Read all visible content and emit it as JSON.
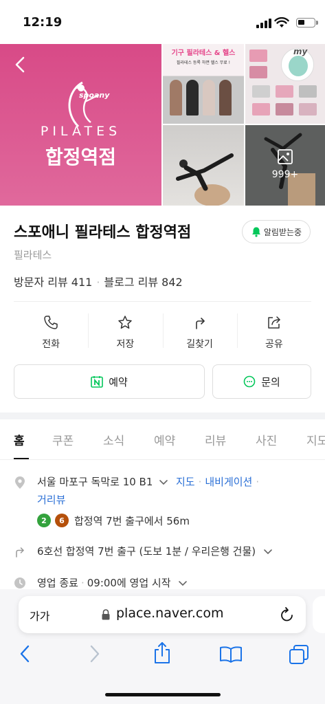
{
  "status": {
    "time": "12:19"
  },
  "hero": {
    "brand": "spoany",
    "pilates": "PILATES",
    "branch": "합정역점",
    "promo_title": "기구 필라테스 & 헬스",
    "promo_sub": "필라테스 등록 하면 헬스 무료 !",
    "my_label": "my",
    "photo_count": "999+"
  },
  "place": {
    "name": "스포애니 필라테스 합정역점",
    "alarm": "알림받는중",
    "category": "필라테스",
    "visitor_review": "방문자 리뷰 411",
    "blog_review": "블로그 리뷰 842"
  },
  "actions": [
    {
      "label": "전화",
      "icon": "phone-icon"
    },
    {
      "label": "저장",
      "icon": "star-icon"
    },
    {
      "label": "길찾기",
      "icon": "directions-icon"
    },
    {
      "label": "공유",
      "icon": "share-icon"
    }
  ],
  "buttons": {
    "reserve": "예약",
    "inquiry": "문의"
  },
  "tabs": [
    "홈",
    "쿠폰",
    "소식",
    "예약",
    "리뷰",
    "사진",
    "지도"
  ],
  "info": {
    "address": "서울 마포구 독막로 10 B1",
    "map_link": "지도",
    "nav_link": "내비게이션",
    "street_view": "거리뷰",
    "line2": "2",
    "line6": "6",
    "subway": "합정역 7번 출구에서 56m",
    "exit": "6호선 합정역 7번 출구 (도보 1분 / 우리은행 건물)",
    "hours_status": "영업 종료",
    "hours_next": "09:00에 영업 시작"
  },
  "browser": {
    "aa": "가가",
    "url": "place.naver.com"
  },
  "colors": {
    "brand_pink": "#d84a87",
    "link_blue": "#2a6fd6",
    "naver_green": "#03c75a",
    "line2": "#33a23d",
    "line6": "#b5500b",
    "ios_blue": "#1a73e8"
  }
}
